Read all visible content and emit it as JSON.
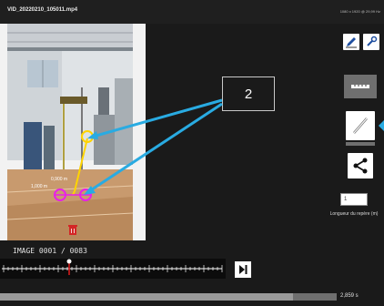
{
  "header": {
    "filename": "VID_20220210_105011.mp4",
    "resolution": "1080 x 1920 @ 29,99 Hz"
  },
  "video": {
    "label_upper": "0,900 m",
    "label_lower": "1,000 m",
    "segment_color": "#ffd400",
    "marker_color": "#e820e8"
  },
  "callout": {
    "number": "2",
    "color": "#29abe2"
  },
  "sidebar": {
    "edit_icon": "pencil-icon",
    "settings_icon": "wrench-icon",
    "scale_icon": "ruler-icon",
    "measure_icon": "pen-icon",
    "share_icon": "share-icon",
    "length_value": "1",
    "length_label": "Longueur du repère (m)"
  },
  "playback": {
    "frame_counter": "IMAGE 0001 / 0083",
    "time": "2,859 s",
    "progress": 0.87,
    "playhead": 0.3
  },
  "colors": {
    "background": "#1a1a1a",
    "trash": "#d32626"
  }
}
